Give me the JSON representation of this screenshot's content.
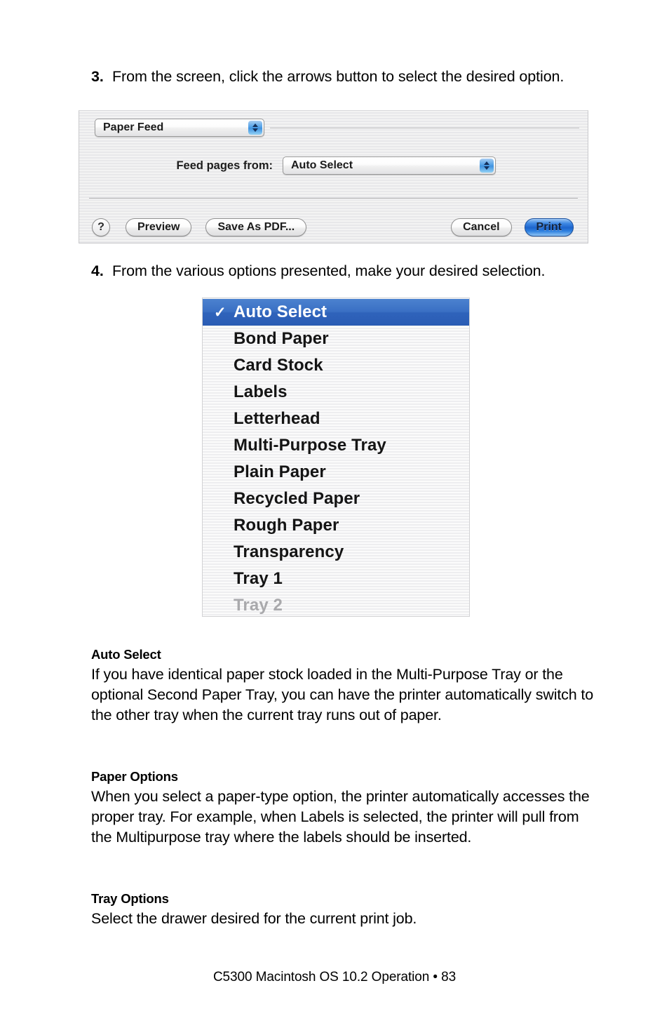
{
  "steps": [
    {
      "number": "3.",
      "text": "From the screen, click the arrows button to select the desired option."
    },
    {
      "number": "4.",
      "text": "From the various options presented, make your desired selection."
    }
  ],
  "print_dialog": {
    "pane_popup": {
      "value": "Paper Feed"
    },
    "feed_field": {
      "label": "Feed pages from:",
      "value": "Auto Select"
    },
    "buttons": {
      "help": "?",
      "preview": "Preview",
      "save_as_pdf": "Save As PDF...",
      "cancel": "Cancel",
      "print": "Print"
    },
    "default_button_color": "#1d64cc"
  },
  "feed_menu": {
    "checkmark": "✓",
    "selected_highlight_color": "#3a6fc4",
    "items": [
      {
        "label": "Auto Select",
        "selected": true,
        "disabled": false
      },
      {
        "label": "Bond Paper",
        "selected": false,
        "disabled": false
      },
      {
        "label": "Card Stock",
        "selected": false,
        "disabled": false
      },
      {
        "label": "Labels",
        "selected": false,
        "disabled": false
      },
      {
        "label": "Letterhead",
        "selected": false,
        "disabled": false
      },
      {
        "label": "Multi-Purpose Tray",
        "selected": false,
        "disabled": false
      },
      {
        "label": "Plain Paper",
        "selected": false,
        "disabled": false
      },
      {
        "label": "Recycled Paper",
        "selected": false,
        "disabled": false
      },
      {
        "label": "Rough Paper",
        "selected": false,
        "disabled": false
      },
      {
        "label": "Transparency",
        "selected": false,
        "disabled": false
      },
      {
        "label": "Tray 1",
        "selected": false,
        "disabled": false
      },
      {
        "label": "Tray 2",
        "selected": false,
        "disabled": true
      }
    ]
  },
  "sections": [
    {
      "heading": "Auto Select",
      "body": "If you have identical paper stock loaded in the Multi-Purpose Tray or the optional Second Paper Tray, you can have the printer automatically switch to the other tray when the current tray runs out of paper."
    },
    {
      "heading": "Paper Options",
      "body": "When you select a paper-type option, the printer automatically accesses the proper tray. For example, when Labels is selected, the printer will pull from the Multipurpose tray where the labels should be inserted."
    },
    {
      "heading": "Tray Options",
      "body": "Select the drawer desired for the current print job."
    }
  ],
  "footer": "C5300 Macintosh OS 10.2 Operation  •  83"
}
